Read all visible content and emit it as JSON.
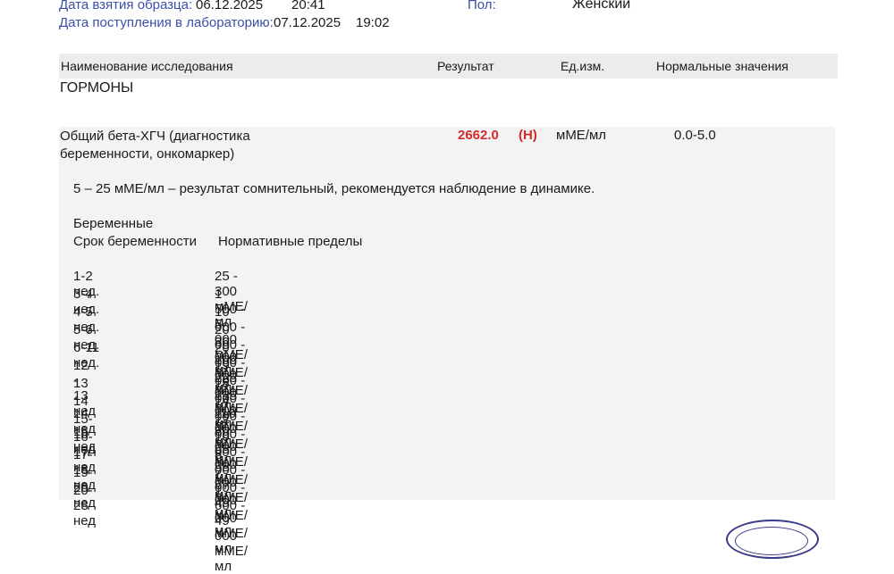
{
  "header": {
    "sample_date_label": "Дата взятия образца:",
    "sample_date": "06.12.2025",
    "sample_time": "20:41",
    "lab_date_label": "Дата поступления в лабораторию:",
    "lab_date": "07.12.2025",
    "lab_time": "19:02",
    "gender_label": "Пол:",
    "gender_value": "Женский"
  },
  "table": {
    "headers": {
      "name": "Наименование исследования",
      "result": "Результат",
      "unit": "Ед.изм.",
      "norm": "Нормальные значения"
    },
    "section": "ГОРМОНЫ",
    "row": {
      "name": "Общий бета-ХГЧ (диагностика беременности, онкомаркер)",
      "result_value": "2662.0",
      "result_flag": "(H)",
      "unit": "мМЕ/мл",
      "norm": "0.0-5.0"
    }
  },
  "comment": {
    "doubtful_note": "5 – 25 мМЕ/мл – результат сомнительный, рекомендуется наблюдение в динамике.",
    "pregnant_title": "Беременные",
    "col_term": "Срок беременности",
    "col_limits": "Нормативные пределы",
    "references": [
      {
        "term": "1-2 нед.",
        "range": "25 - 300 мМЕ/мл"
      },
      {
        "term": "3-4 нед.",
        "range": "1 500 - 5 000 мМЕ/мл"
      },
      {
        "term": "4-5 нед.",
        "range": "10 000 - 30 000 мМЕ/мл"
      },
      {
        "term": "5-6 нед.",
        "range": "20 000 - 100 000 мМЕ/мл"
      },
      {
        "term": "6-11 нед.",
        "range": "20 000 - 225 000 мМЕ/мл"
      },
      {
        "term": "12 - 13 нед",
        "range": "19 000 - 135 000 мМЕ/мл"
      },
      {
        "term": "13 - 14 нед",
        "range": "18 000 - 110 000 мМЕ/мл"
      },
      {
        "term": "14 - 15 нед",
        "range": "14 000 - 80 000 мМЕ/мл"
      },
      {
        "term": "15-16 нед",
        "range": "12 000 - 68 000 мМЕ/мл"
      },
      {
        "term": "16-17 нед",
        "range": "10 000 - 58 000 мМЕ/мл"
      },
      {
        "term": "17-18 нед",
        "range": "8 000 - 57 000 мМЕ/мл"
      },
      {
        "term": "19-20 нед",
        "range": "7 000 - 49 000 мМЕ/мл"
      },
      {
        "term": "20-28 нед",
        "range": "1 600 - 49 000 мМЕ/мл"
      }
    ]
  },
  "colors": {
    "label_blue": "#3b4fa8",
    "flag_red": "#d42a2a",
    "header_bg": "#ececec",
    "block_bg": "#f3f3f3"
  }
}
